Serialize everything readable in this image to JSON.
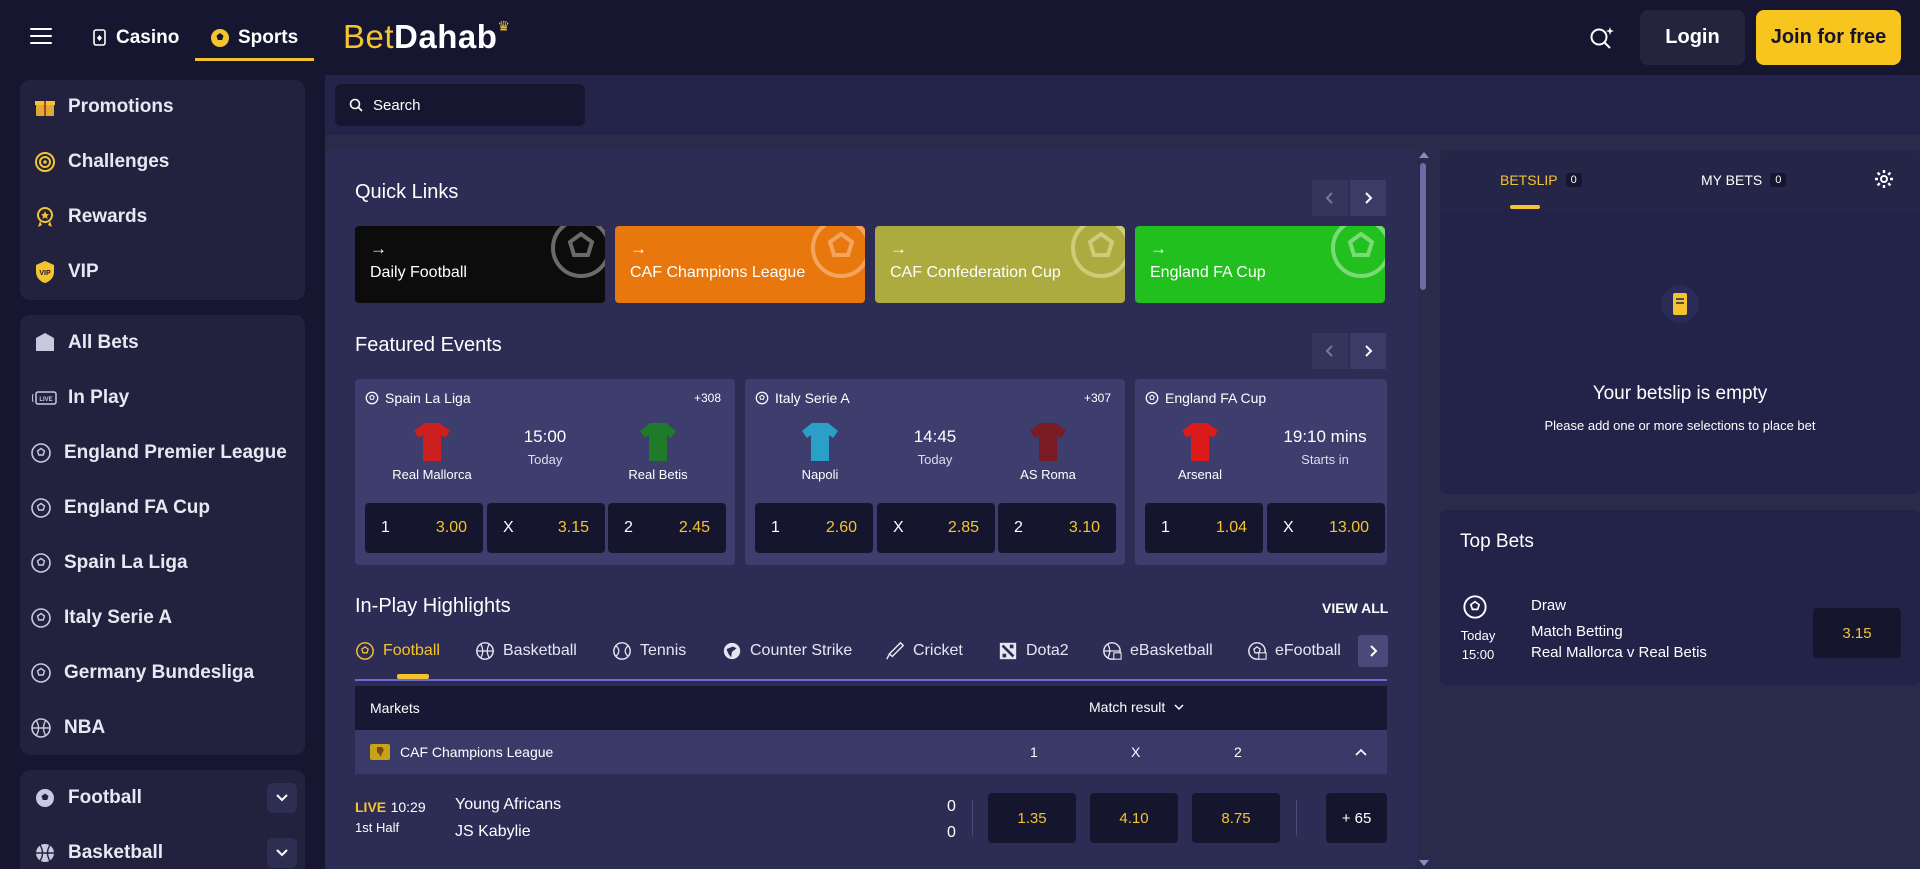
{
  "header": {
    "tabs": [
      {
        "label": "Casino"
      },
      {
        "label": "Sports"
      }
    ],
    "logo": {
      "part1": "Bet",
      "part2": "Dahab"
    },
    "login_label": "Login",
    "join_label": "Join for free"
  },
  "sidebar": {
    "group1": [
      {
        "label": "Promotions",
        "icon": "gift-icon"
      },
      {
        "label": "Challenges",
        "icon": "target-icon"
      },
      {
        "label": "Rewards",
        "icon": "award-icon"
      },
      {
        "label": "VIP",
        "icon": "vip-shield-icon"
      }
    ],
    "group2": [
      {
        "label": "All Bets",
        "icon": "tag-icon"
      },
      {
        "label": "In Play",
        "icon": "live-icon"
      },
      {
        "label": "England Premier League",
        "icon": "football-icon"
      },
      {
        "label": "England FA Cup",
        "icon": "football-icon"
      },
      {
        "label": "Spain La Liga",
        "icon": "football-icon"
      },
      {
        "label": "Italy Serie A",
        "icon": "football-icon"
      },
      {
        "label": "Germany Bundesliga",
        "icon": "football-icon"
      },
      {
        "label": "NBA",
        "icon": "basketball-icon"
      }
    ],
    "group3": [
      {
        "label": "Football",
        "icon": "football-icon"
      },
      {
        "label": "Basketball",
        "icon": "basketball-icon"
      }
    ]
  },
  "search": {
    "placeholder": "Search"
  },
  "quick_links": {
    "title": "Quick Links",
    "items": [
      {
        "label": "Daily Football",
        "arrow": "→",
        "color": "#0c0c0c"
      },
      {
        "label": "CAF Champions League",
        "arrow": "→",
        "color": "#e8780e"
      },
      {
        "label": "CAF Confederation Cup",
        "arrow": "→",
        "color": "#abab40"
      },
      {
        "label": "England FA Cup",
        "arrow": "→",
        "color": "#22c01e"
      }
    ]
  },
  "featured": {
    "title": "Featured Events",
    "events": [
      {
        "league": "Spain La Liga",
        "count": "+308",
        "home": "Real Mallorca",
        "away": "Real Betis",
        "time": "15:00",
        "sub": "Today",
        "home_color": "#cc1f1f",
        "away_color": "#1f7a2a",
        "odds": [
          {
            "k": "1",
            "v": "3.00"
          },
          {
            "k": "X",
            "v": "3.15"
          },
          {
            "k": "2",
            "v": "2.45"
          }
        ]
      },
      {
        "league": "Italy Serie A",
        "count": "+307",
        "home": "Napoli",
        "away": "AS Roma",
        "time": "14:45",
        "sub": "Today",
        "home_color": "#2aa0c8",
        "away_color": "#7a1a22",
        "odds": [
          {
            "k": "1",
            "v": "2.60"
          },
          {
            "k": "X",
            "v": "2.85"
          },
          {
            "k": "2",
            "v": "3.10"
          }
        ]
      },
      {
        "league": "England FA Cup",
        "count": "",
        "home": "Arsenal",
        "away": "",
        "time": "19:10 mins",
        "sub": "Starts in",
        "home_color": "#dd1a1a",
        "away_color": "",
        "odds": [
          {
            "k": "1",
            "v": "1.04"
          },
          {
            "k": "X",
            "v": "13.00"
          }
        ]
      }
    ]
  },
  "inplay": {
    "title": "In-Play Highlights",
    "view_all": "VIEW ALL",
    "tabs": [
      "Football",
      "Basketball",
      "Tennis",
      "Counter Strike",
      "Cricket",
      "Dota2",
      "eBasketball",
      "eFootball"
    ],
    "markets_label": "Markets",
    "market_select": "Match result",
    "league": "CAF Champions League",
    "cols": [
      "1",
      "X",
      "2"
    ],
    "match": {
      "live": "LIVE",
      "clock": "10:29",
      "period": "1st Half",
      "home": "Young Africans",
      "away": "JS Kabylie",
      "home_score": "0",
      "away_score": "0",
      "odds": [
        "1.35",
        "4.10",
        "8.75"
      ],
      "more": "+ 65"
    }
  },
  "betslip": {
    "tab1": "BETSLIP",
    "tab1_count": "0",
    "tab2": "MY BETS",
    "tab2_count": "0",
    "empty_title": "Your betslip is empty",
    "empty_sub": "Please add one or more selections to place bet"
  },
  "top_bets": {
    "title": "Top Bets",
    "item": {
      "day": "Today",
      "time": "15:00",
      "selection": "Draw",
      "market": "Match Betting",
      "event": "Real Mallorca v Real Betis",
      "odd": "3.15"
    }
  },
  "colors": {
    "accent": "#f4c430",
    "bg_dark": "#161630",
    "panel": "#2c2c55"
  }
}
